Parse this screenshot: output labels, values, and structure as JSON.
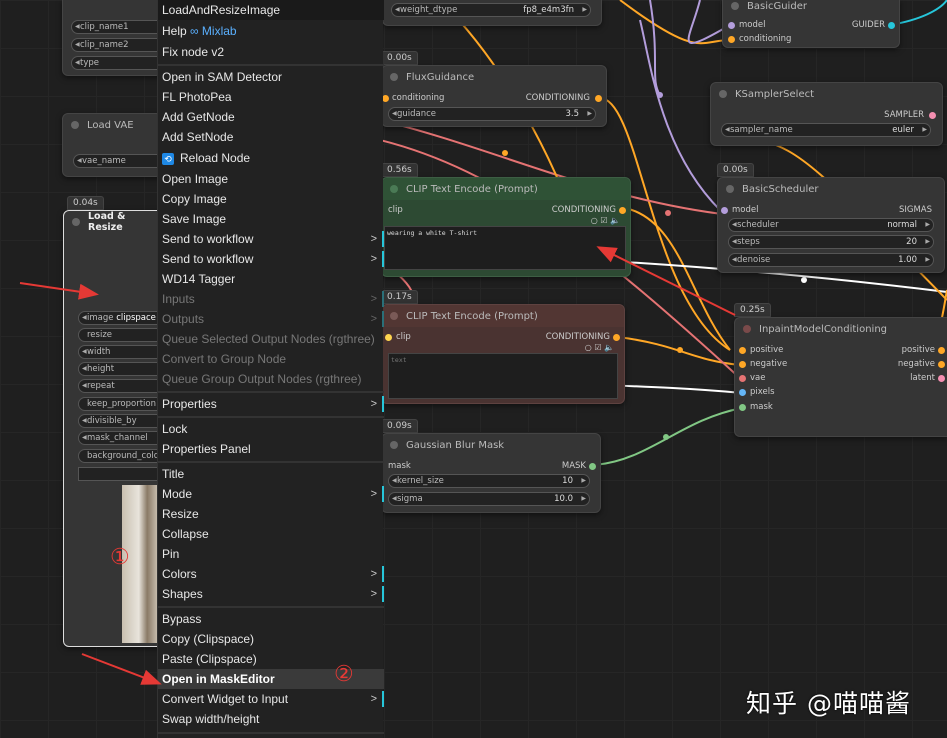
{
  "menu": {
    "title": "LoadAndResizeImage",
    "items": [
      {
        "label": "Help",
        "extra": "∞ Mixlab"
      },
      {
        "label": "Fix node v2"
      },
      {
        "label": "Open in SAM Detector"
      },
      {
        "label": "FL PhotoPea"
      },
      {
        "label": "Add GetNode"
      },
      {
        "label": "Add SetNode"
      },
      {
        "label": "Reload Node"
      },
      {
        "label": "Open Image"
      },
      {
        "label": "Copy Image"
      },
      {
        "label": "Save Image"
      },
      {
        "label": "Send to workflow",
        "submenu": ">"
      },
      {
        "label": "Send to workflow",
        "submenu": ">"
      },
      {
        "label": "WD14 Tagger"
      },
      {
        "label": "Inputs",
        "submenu": ">"
      },
      {
        "label": "Outputs",
        "submenu": ">"
      },
      {
        "label": "Queue Selected Output Nodes (rgthree)"
      },
      {
        "label": "Convert to Group Node"
      },
      {
        "label": "Queue Group Output Nodes (rgthree)"
      },
      {
        "label": "Properties",
        "submenu": ">"
      },
      {
        "label": "Lock"
      },
      {
        "label": "Properties Panel"
      },
      {
        "label": "Title"
      },
      {
        "label": "Mode",
        "submenu": ">"
      },
      {
        "label": "Resize"
      },
      {
        "label": "Collapse"
      },
      {
        "label": "Pin"
      },
      {
        "label": "Colors",
        "submenu": ">"
      },
      {
        "label": "Shapes",
        "submenu": ">"
      },
      {
        "label": "Bypass"
      },
      {
        "label": "Copy (Clipspace)"
      },
      {
        "label": "Paste (Clipspace)"
      },
      {
        "label": "Open in MaskEditor"
      },
      {
        "label": "Convert Widget to Input",
        "submenu": ">"
      },
      {
        "label": "Swap width/height"
      }
    ]
  },
  "nodes": {
    "clip_loader": {
      "w1": "clip_name1",
      "w2": "clip_name2",
      "w3": "type"
    },
    "load_vae": {
      "title": "Load VAE",
      "w1": "vae_name"
    },
    "load_resize": {
      "time": "0.04s",
      "title": "Load & Resize",
      "w_image": "image",
      "w_image_val": "clipspace",
      "w_resize": "resize",
      "w_width": "width",
      "w_height": "height",
      "w_repeat": "repeat",
      "w_keep": "keep_proportion",
      "w_div": "divisible_by",
      "w_mask": "mask_channel",
      "w_bg": "background_color"
    },
    "weight": {
      "label": "weight_dtype",
      "value": "fp8_e4m3fn"
    },
    "flux": {
      "time": "0.00s",
      "title": "FluxGuidance",
      "in": "conditioning",
      "out": "CONDITIONING",
      "w": "guidance",
      "wv": "3.5"
    },
    "clip_pos": {
      "time": "0.56s",
      "title": "CLIP Text Encode (Prompt)",
      "in": "clip",
      "out": "CONDITIONING",
      "text": "wearing a white T-shirt"
    },
    "clip_neg": {
      "time": "0.17s",
      "title": "CLIP Text Encode (Prompt)",
      "in": "clip",
      "out": "CONDITIONING",
      "text": "text"
    },
    "blur": {
      "time": "0.09s",
      "title": "Gaussian Blur Mask",
      "in": "mask",
      "out": "MASK",
      "w1": "kernel_size",
      "w1v": "10",
      "w2": "sigma",
      "w2v": "10.0"
    },
    "guider": {
      "title": "BasicGuider",
      "in1": "model",
      "in2": "conditioning",
      "out": "GUIDER"
    },
    "ksampler": {
      "title": "KSamplerSelect",
      "out": "SAMPLER",
      "w": "sampler_name",
      "wv": "euler"
    },
    "sched": {
      "time": "0.00s",
      "title": "BasicScheduler",
      "in": "model",
      "out": "SIGMAS",
      "w1": "scheduler",
      "w1v": "normal",
      "w2": "steps",
      "w2v": "20",
      "w3": "denoise",
      "w3v": "1.00"
    },
    "inpaint": {
      "time": "0.25s",
      "title": "InpaintModelConditioning",
      "in1": "positive",
      "in2": "negative",
      "in3": "vae",
      "in4": "pixels",
      "in5": "mask",
      "out1": "positive",
      "out2": "negative",
      "out3": "latent"
    }
  },
  "annotations": {
    "one": "①",
    "two": "②"
  },
  "watermark": "知乎 @喵喵酱",
  "colors": {
    "accent": "#26c6da",
    "arrow": "#e53935",
    "wire_clip": "#e57373",
    "wire_cond": "#ffa726",
    "wire_model": "#b39ddb",
    "wire_mask": "#81c784",
    "wire_pixels": "#ffffff"
  }
}
